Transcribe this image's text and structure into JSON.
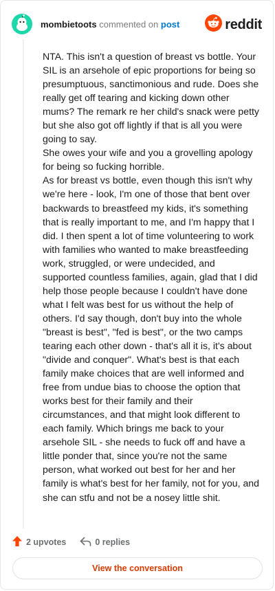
{
  "header": {
    "username": "mombietoots",
    "action": "commented on",
    "post_link": "post",
    "avatar_icon": "snoo-avatar-icon",
    "brand": "reddit",
    "brand_icon": "reddit-logo-icon"
  },
  "comment": {
    "paragraphs": [
      "NTA. This isn't a question of breast vs bottle. Your SIL is an arsehole of epic proportions for being so presumptuous, sanctimonious and rude. Does she really get off tearing and kicking down other mums? The remark re her child's snack were petty but she also got off lightly if that is all you were going to say.",
      "She owes your wife and you a grovelling apology for being so fucking horrible.",
      "As for breast vs bottle, even though this isn't why we're here - look, I'm one of those that bent over backwards to breastfeed my kids, it's something that is really important to me, and I'm happy that I did. I then spent a lot of time volunteering to work with families who wanted to make breastfeeding work, struggled, or were undecided, and supported countless families, again, glad that I did help those people because I couldn't have done what I felt was best for us without the help of others. I'd say though, don't buy into the whole \"breast is best\", \"fed is best\", or the two camps tearing each other down - that's all it is, it's about \"divide and conquer\". What's best is that each family make choices that are well informed and free from undue bias to choose the option that works best for their family and their circumstances, and that might look different to each family. Which brings me back to your arsehole SIL - she needs to fuck off and have a little ponder that, since you're not the same person, what worked out best for her and her family is what's best for her family, not for you, and she can stfu and not be a nosey little shit."
    ]
  },
  "footer": {
    "upvotes": "2 upvotes",
    "replies": "0 replies",
    "view_button": "View the conversation"
  },
  "colors": {
    "accent": "#ff4500",
    "link": "#0079d3",
    "avatar": "#1bd7a9",
    "button_text": "#d93a00"
  }
}
